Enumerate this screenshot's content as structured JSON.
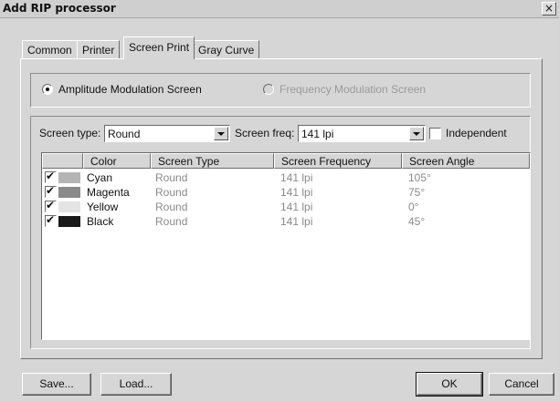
{
  "window": {
    "title": "Add RIP processor",
    "close_glyph": "×"
  },
  "tabs": [
    {
      "label": "Common"
    },
    {
      "label": "Printer"
    },
    {
      "label": "Screen Print",
      "active": true
    },
    {
      "label": "Gray Curve"
    }
  ],
  "modulation": {
    "amplitude_label": "Amplitude Modulation Screen",
    "amplitude_selected": true,
    "frequency_label": "Frequency Modulation Screen",
    "frequency_enabled": false
  },
  "screen_settings": {
    "screen_type_label": "Screen type:",
    "screen_type_value": "Round",
    "screen_freq_label": "Screen freq:",
    "screen_freq_value": "141 lpi",
    "independent_label": "Independent",
    "independent_checked": false
  },
  "table": {
    "columns": [
      "Color",
      "Screen Type",
      "Screen Frequency",
      "Screen Angle"
    ],
    "rows": [
      {
        "checked": true,
        "swatch": "#b4b4b4",
        "color": "Cyan",
        "screen_type": "Round",
        "frequency": "141 lpi",
        "angle": "105°"
      },
      {
        "checked": true,
        "swatch": "#8a8a8a",
        "color": "Magenta",
        "screen_type": "Round",
        "frequency": "141 lpi",
        "angle": "75°"
      },
      {
        "checked": true,
        "swatch": "#e4e4e4",
        "color": "Yellow",
        "screen_type": "Round",
        "frequency": "141 lpi",
        "angle": "0°"
      },
      {
        "checked": true,
        "swatch": "#1a1a1a",
        "color": "Black",
        "screen_type": "Round",
        "frequency": "141 lpi",
        "angle": "45°"
      }
    ]
  },
  "buttons": {
    "save": "Save...",
    "load": "Load...",
    "ok": "OK",
    "cancel": "Cancel"
  },
  "check_glyph": "✔"
}
